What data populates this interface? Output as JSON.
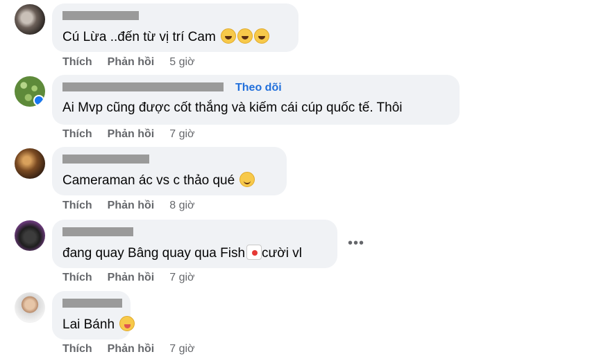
{
  "actions": {
    "like": "Thích",
    "reply": "Phản hồi"
  },
  "comments": [
    {
      "text": "Cú Lừa ..đến từ vị trí Cam",
      "time": "5 giờ",
      "emoji": [
        "rolling-on-floor-laughing",
        "rolling-on-floor-laughing",
        "rolling-on-floor-laughing"
      ]
    },
    {
      "text": "Ai Mvp cũng được cốt thắng và kiếm cái cúp quốc tế. Thôi",
      "time": "7 giờ",
      "follow": "Theo dõi"
    },
    {
      "text": "Cameraman ác vs c thảo qué",
      "time": "8 giờ",
      "emoji": [
        "grinning-sweat"
      ]
    },
    {
      "text_before": "đang quay Bâng quay qua Fish",
      "text_after": "cười vl",
      "time": "7 giờ",
      "emoji": [
        "clown-face"
      ],
      "more": "•••"
    },
    {
      "text": "Lai Bánh",
      "time": "7 giờ",
      "emoji": [
        "squinting-tongue"
      ]
    }
  ]
}
